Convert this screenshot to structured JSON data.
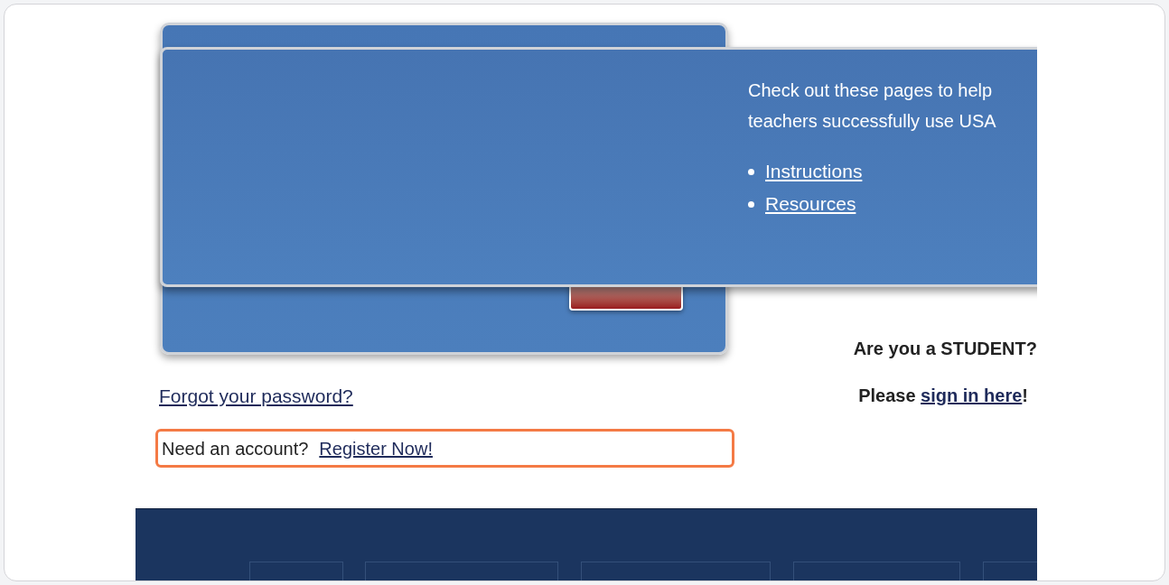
{
  "login": {
    "signin_button": {
      "kind": "covered"
    },
    "forgot_link": "Forgot your password?",
    "register": {
      "prompt": "Need an account?",
      "link": "Register Now!",
      "highlighted": true
    }
  },
  "overlay": {
    "lines": [
      "Check out these pages to help",
      "teachers successfully use USA"
    ],
    "links": [
      "Instructions",
      "Resources"
    ]
  },
  "student": {
    "question": "Are you a STUDENT?",
    "prompt": "Please ",
    "link": "sign in here",
    "suffix": "!"
  }
}
